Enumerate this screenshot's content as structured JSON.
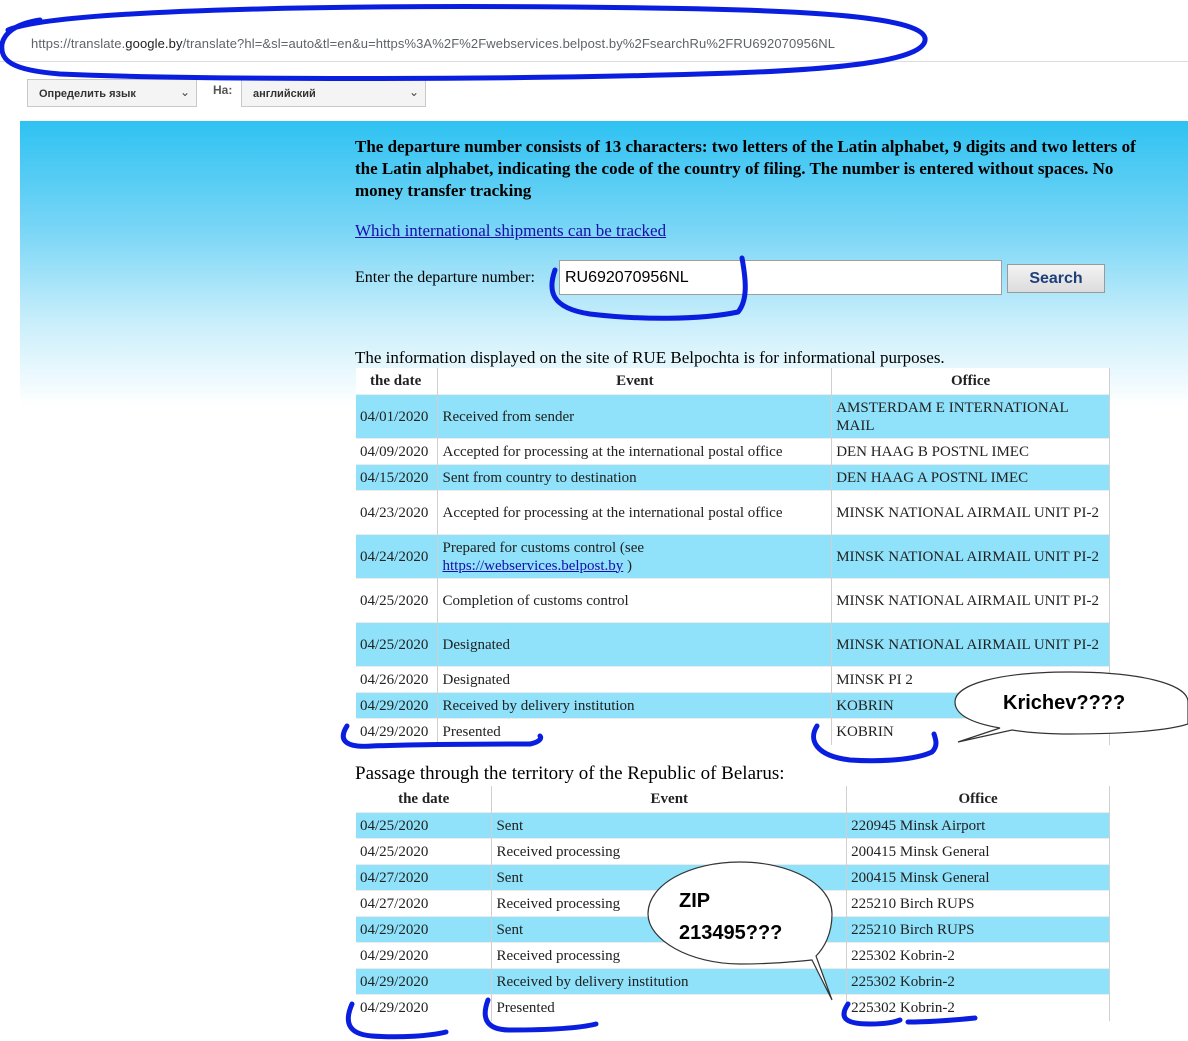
{
  "browser": {
    "url_prefix": "https://translate.",
    "url_domain": "google.by",
    "url_suffix": "/translate?hl=&sl=auto&tl=en&u=https%3A%2F%2Fwebservices.belpost.by%2FsearchRu%2FRU692070956NL"
  },
  "translate_bar": {
    "source_lang": "Определить язык",
    "to_label": "На:",
    "target_lang": "английский"
  },
  "page": {
    "intro": "The departure number consists of 13 characters: two letters of the Latin alphabet, 9 digits and two letters of the Latin alphabet, indicating the code of the country of filing. The number is entered without spaces. No money transfer tracking",
    "tracking_link": "Which international shipments can be tracked",
    "enter_label": "Enter the departure number:",
    "tracking_number": "RU692070956NL",
    "search_label": "Search",
    "info_text": "The information displayed on the site of RUE Belpochta is for informational purposes.",
    "passage_title": "Passage through the territory of the Republic of Belarus:"
  },
  "table1": {
    "headers": [
      "the date",
      "Event",
      "Office"
    ],
    "rows": [
      {
        "date": "04/01/2020",
        "event": "Received from sender",
        "office": "AMSTERDAM E INTERNATIONAL MAIL"
      },
      {
        "date": "04/09/2020",
        "event": "Accepted for processing at the international postal office",
        "office": "DEN HAAG B POSTNL IMEC"
      },
      {
        "date": "04/15/2020",
        "event": "Sent from country to destination",
        "office": "DEN HAAG A POSTNL IMEC"
      },
      {
        "date": "04/23/2020",
        "event": "Accepted for processing at the international postal office",
        "office": "MINSK NATIONAL AIRMAIL UNIT PI-2"
      },
      {
        "date": "04/24/2020",
        "event": "Prepared for customs control (see",
        "event_link": "https://webservices.belpost.by",
        "event_tail": ")",
        "office": "MINSK NATIONAL AIRMAIL UNIT PI-2"
      },
      {
        "date": "04/25/2020",
        "event": "Completion of customs control",
        "office": "MINSK NATIONAL AIRMAIL UNIT PI-2"
      },
      {
        "date": "04/25/2020",
        "event": "Designated",
        "office": "MINSK NATIONAL AIRMAIL UNIT PI-2"
      },
      {
        "date": "04/26/2020",
        "event": "Designated",
        "office": "MINSK PI 2"
      },
      {
        "date": "04/29/2020",
        "event": "Received by delivery institution",
        "office": "KOBRIN"
      },
      {
        "date": "04/29/2020",
        "event": "Presented",
        "office": "KOBRIN"
      }
    ]
  },
  "table2": {
    "headers": [
      "the date",
      "Event",
      "Office"
    ],
    "rows": [
      {
        "date": "04/25/2020",
        "event": "Sent",
        "office": "220945 Minsk Airport"
      },
      {
        "date": "04/25/2020",
        "event": "Received processing",
        "office": "200415 Minsk General"
      },
      {
        "date": "04/27/2020",
        "event": "Sent",
        "office": "200415 Minsk General"
      },
      {
        "date": "04/27/2020",
        "event": "Received processing",
        "office": "225210 Birch RUPS"
      },
      {
        "date": "04/29/2020",
        "event": "Sent",
        "office": "225210 Birch RUPS"
      },
      {
        "date": "04/29/2020",
        "event": "Received processing",
        "office": "225302 Kobrin-2"
      },
      {
        "date": "04/29/2020",
        "event": "Received by delivery institution",
        "office": "225302 Kobrin-2"
      },
      {
        "date": "04/29/2020",
        "event": "Presented",
        "office": "225302 Kobrin-2"
      }
    ]
  },
  "annotations": {
    "bubble1": "Krichev????",
    "bubble2_line1": "ZIP",
    "bubble2_line2": "213495???"
  },
  "colors": {
    "row_blue": "#8fe2fa",
    "annotation_ink": "#0a1ee0",
    "link": "#1a0dab"
  }
}
